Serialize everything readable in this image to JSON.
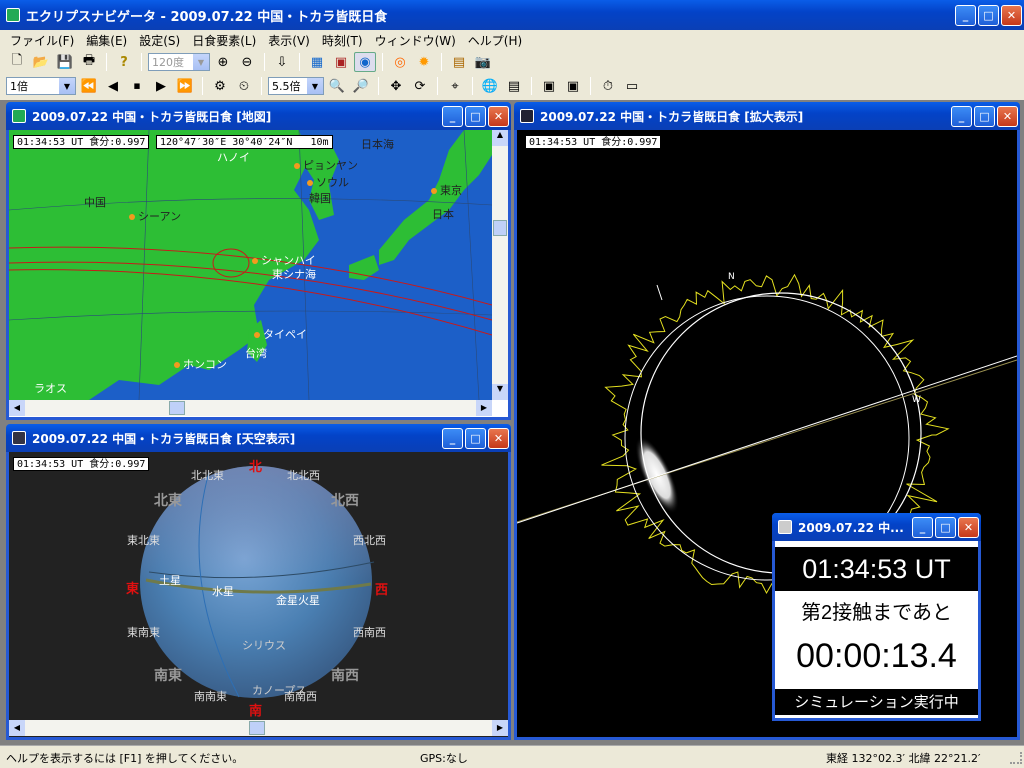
{
  "app": {
    "title": "エクリプスナビゲータ - 2009.07.22 中国・トカラ皆既日食"
  },
  "menu": [
    "ファイル(F)",
    "編集(E)",
    "設定(S)",
    "日食要素(L)",
    "表示(V)",
    "時刻(T)",
    "ウィンドウ(W)",
    "ヘルプ(H)"
  ],
  "toolbar": {
    "zoom_combo": "120度",
    "speed_combo": "1倍",
    "mag_combo": "5.5倍"
  },
  "map_window": {
    "title": "2009.07.22 中国・トカラ皆既日食 [地図]",
    "time_info": "01:34:53 UT 食分:0.997",
    "coord_info": "120°47′30″E 30°40′24″N",
    "scale": "10m",
    "labels": {
      "china": "中国",
      "japan": "日本",
      "japan_sea": "日本海",
      "xian": "シーアン",
      "pyongyang": "ピョンヤン",
      "seoul": "ソウル",
      "korea": "韓国",
      "tokyo": "東京",
      "shanghai": "シャンハイ",
      "east_china_sea": "東シナ海",
      "taipei": "タイペイ",
      "taiwan": "台湾",
      "hongkong": "ホンコン",
      "laos": "ラオス",
      "hanoi": "ハノイ"
    }
  },
  "sky_window": {
    "title": "2009.07.22 中国・トカラ皆既日食 [天空表示]",
    "time_info": "01:34:53 UT 食分:0.997",
    "dirs": {
      "n": "北",
      "s": "南",
      "e": "東",
      "w": "西",
      "ne": "北東",
      "nw": "北西",
      "se": "南東",
      "sw": "南西",
      "nne": "北北東",
      "nnw": "北北西",
      "ene": "東北東",
      "wnw": "西北西",
      "ese": "東南東",
      "wsw": "西南西",
      "sse": "南南東",
      "ssw": "南南西"
    },
    "objects": {
      "saturn": "土星",
      "mercury": "水星",
      "venus": "金星",
      "mars": "火星",
      "sirius": "シリウス",
      "canopus": "カノープス"
    }
  },
  "zoom_window": {
    "title": "2009.07.22 中国・トカラ皆既日食 [拡大表示]",
    "time_info": "01:34:53 UT 食分:0.997",
    "n_label": "N",
    "w_label": "W"
  },
  "timer_window": {
    "title": "2009.07.22 中...",
    "time": "01:34:53 UT",
    "caption": "第2接触まであと",
    "countdown": "00:00:13.4",
    "status": "シミュレーション実行中"
  },
  "statusbar": {
    "help": "ヘルプを表示するには [F1] を押してください。",
    "gps": "GPS:なし",
    "position": "東経 132°02.3′ 北緯 22°21.2′"
  }
}
